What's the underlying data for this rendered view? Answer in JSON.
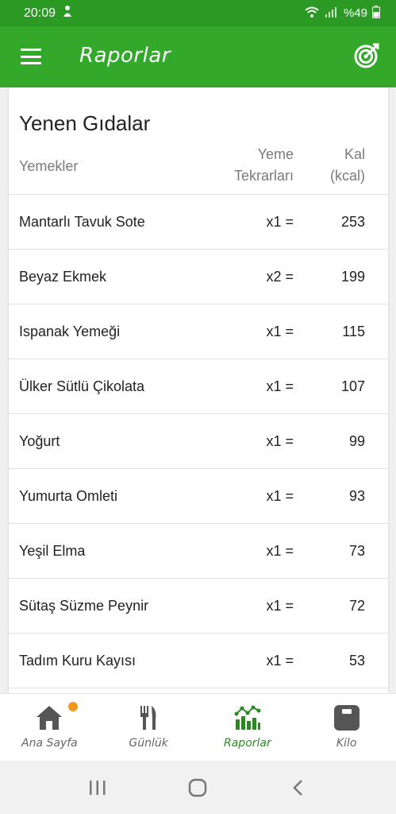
{
  "status_bar": {
    "time": "20:09",
    "battery": "%49"
  },
  "app_bar": {
    "title": "Raporlar"
  },
  "report": {
    "title": "Yenen Gıdalar",
    "col_food": "Yemekler",
    "col_rep_1": "Yeme",
    "col_rep_2": "Tekrarları",
    "col_kcal_1": "Kal",
    "col_kcal_2": "(kcal)",
    "rows": [
      {
        "name": "Mantarlı Tavuk Sote",
        "rep": "x1 =",
        "kcal": "253"
      },
      {
        "name": "Beyaz Ekmek",
        "rep": "x2 =",
        "kcal": "199"
      },
      {
        "name": "Ispanak Yemeği",
        "rep": "x1 =",
        "kcal": "115"
      },
      {
        "name": "Ülker Sütlü Çikolata",
        "rep": "x1 =",
        "kcal": "107"
      },
      {
        "name": "Yoğurt",
        "rep": "x1 =",
        "kcal": "99"
      },
      {
        "name": "Yumurta Omleti",
        "rep": "x1 =",
        "kcal": "93"
      },
      {
        "name": "Yeşil Elma",
        "rep": "x1 =",
        "kcal": "73"
      },
      {
        "name": "Sütaş Süzme Peynir",
        "rep": "x1 =",
        "kcal": "72"
      },
      {
        "name": "Tadım Kuru Kayısı",
        "rep": "x1 =",
        "kcal": "53"
      }
    ]
  },
  "bottom_nav": {
    "items": [
      {
        "label": "Ana Sayfa",
        "icon": "home-icon"
      },
      {
        "label": "Günlük",
        "icon": "cutlery-icon"
      },
      {
        "label": "Raporlar",
        "icon": "chart-icon"
      },
      {
        "label": "Kilo",
        "icon": "scale-icon"
      }
    ],
    "active_color": "#2a8a22",
    "badge_color": "#f2961e"
  },
  "colors": {
    "status_bar": "#2a9a25",
    "app_bar": "#34a82b"
  }
}
